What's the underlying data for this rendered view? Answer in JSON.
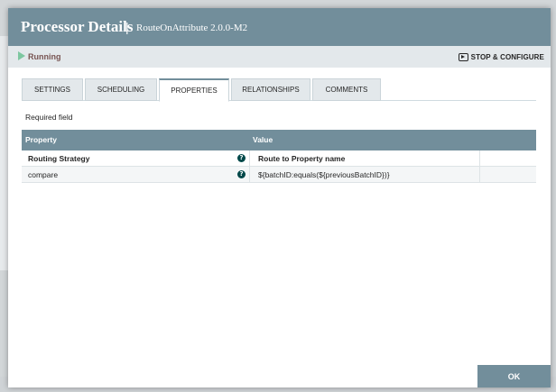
{
  "dialog": {
    "title": "Processor Details",
    "separator": "|",
    "subtitle": "RouteOnAttribute 2.0.0-M2"
  },
  "status": {
    "state": "Running",
    "stop_configure_label": "STOP & CONFIGURE"
  },
  "tabs": [
    {
      "label": "SETTINGS",
      "active": false
    },
    {
      "label": "SCHEDULING",
      "active": false
    },
    {
      "label": "PROPERTIES",
      "active": true
    },
    {
      "label": "RELATIONSHIPS",
      "active": false
    },
    {
      "label": "COMMENTS",
      "active": false
    }
  ],
  "required_field_label": "Required field",
  "properties_table": {
    "columns": [
      "Property",
      "Value"
    ],
    "rows": [
      {
        "name": "Routing Strategy",
        "value": "Route to Property name",
        "required": true,
        "help": "?"
      },
      {
        "name": "compare",
        "value": "${batchID:equals(${previousBatchID})}",
        "required": false,
        "help": "?"
      }
    ]
  },
  "footer": {
    "ok_label": "OK"
  },
  "colors": {
    "header": "#728e9b",
    "running": "#7dc7a0",
    "status_bg": "#e3e8eb"
  }
}
